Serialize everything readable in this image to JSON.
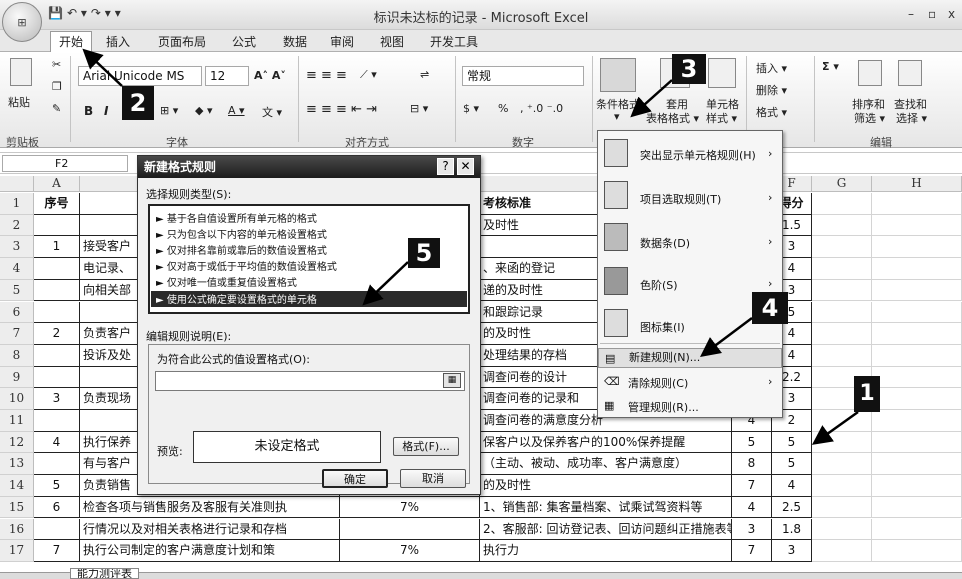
{
  "window": {
    "title": "标识未达标的记录 - Microsoft Excel",
    "controls": [
      "–",
      "▫",
      "x"
    ]
  },
  "qat": [
    "💾",
    "↶ ▾",
    "↷ ▾",
    "▾"
  ],
  "ribbon_tabs": [
    "开始",
    "插入",
    "页面布局",
    "公式",
    "数据",
    "审阅",
    "视图",
    "开发工具"
  ],
  "ribbon": {
    "clipboard": {
      "label": "剪贴板",
      "paste": "粘贴"
    },
    "font": {
      "label": "字体",
      "name": "Arial Unicode MS",
      "size": "12",
      "bold": "B",
      "italic": "I"
    },
    "align": {
      "label": "对齐方式"
    },
    "number": {
      "label": "数字",
      "format": "常规",
      "pct": "%"
    },
    "styles": {
      "cond_line1": "条件格式",
      "cond_line2": "▾",
      "table_line1": "套用",
      "table_line2": "表格格式 ▾",
      "cell_line1": "单元格",
      "cell_line2": "样式 ▾",
      "label": "样式"
    },
    "cells": {
      "insert": "插入 ▾",
      "delete": "删除 ▾",
      "format": "格式 ▾",
      "label": "单元格"
    },
    "editing": {
      "sort1": "排序和",
      "sort2": "筛选 ▾",
      "find1": "查找和",
      "find2": "选择 ▾",
      "label": "编辑",
      "sigma": "Σ ▾"
    }
  },
  "formula_bar": {
    "cell_ref": "F2"
  },
  "columns": [
    "A",
    "B",
    "C",
    "D",
    "E",
    "F",
    "G",
    "H"
  ],
  "rows": [
    {
      "n": "1",
      "a": "序号",
      "b": "",
      "d": "考核标准",
      "e": "",
      "f": "得分"
    },
    {
      "n": "2",
      "a": "",
      "b": "",
      "d": "及时性",
      "e": "",
      "f": "1.5"
    },
    {
      "n": "3",
      "a": "1",
      "b": "接受客户",
      "d": "",
      "e": "",
      "f": "3"
    },
    {
      "n": "4",
      "a": "",
      "b": "电记录、",
      "d": "、来函的登记",
      "e": "",
      "f": "4"
    },
    {
      "n": "5",
      "a": "",
      "b": "向相关部",
      "d": "递的及时性",
      "e": "",
      "f": "3"
    },
    {
      "n": "6",
      "a": "",
      "b": "",
      "d": "和跟踪记录",
      "e": "",
      "f": "5"
    },
    {
      "n": "7",
      "a": "2",
      "b": "负责客户",
      "d": "的及时性",
      "e": "",
      "f": "4"
    },
    {
      "n": "8",
      "a": "",
      "b": "投诉及处",
      "d": "处理结果的存档",
      "e": "",
      "f": "4"
    },
    {
      "n": "9",
      "a": "",
      "b": "",
      "d": "调查问卷的设计",
      "e": "",
      "f": "2.2"
    },
    {
      "n": "10",
      "a": "3",
      "b": "负责现场",
      "d": "调查问卷的记录和",
      "e": "",
      "f": "3"
    },
    {
      "n": "11",
      "a": "",
      "b": "",
      "d": "调查问卷的满意度分析",
      "e": "4",
      "f": "2"
    },
    {
      "n": "12",
      "a": "4",
      "b": "执行保养",
      "d": "保客户以及保养客户的100%保养提醒",
      "e": "5",
      "f": "5"
    },
    {
      "n": "13",
      "a": "",
      "b": "有与客户",
      "d": "（主动、被动、成功率、客户满意度）",
      "e": "8",
      "f": "5"
    },
    {
      "n": "14",
      "a": "5",
      "b": "负责销售",
      "d": "的及时性",
      "e": "7",
      "f": "4"
    },
    {
      "n": "15",
      "a": "6",
      "b": "检查各项与销售服务及客服有关准则执",
      "c": "7%",
      "d": "1、销售部: 集客量档案、试乘试驾资料等",
      "e": "4",
      "f": "2.5"
    },
    {
      "n": "16",
      "a": "",
      "b": "行情况以及对相关表格进行记录和存档",
      "c": "",
      "d": "2、客服部: 回访登记表、回访问题纠正措施表等",
      "e": "3",
      "f": "1.8"
    },
    {
      "n": "17",
      "a": "7",
      "b": "执行公司制定的客户满意度计划和策",
      "c": "7%",
      "d": "执行力",
      "e": "7",
      "f": "3"
    }
  ],
  "sheet_tab": "能力测评表",
  "dialog": {
    "title": "新建格式规则",
    "help": "?",
    "close": "✕",
    "select_label": "选择规则类型(S):",
    "rules": [
      "► 基于各自值设置所有单元格的格式",
      "► 只为包含以下内容的单元格设置格式",
      "► 仅对排名靠前或靠后的数值设置格式",
      "► 仅对高于或低于平均值的数值设置格式",
      "► 仅对唯一值或重复值设置格式",
      "► 使用公式确定要设置格式的单元格"
    ],
    "edit_label": "编辑规则说明(E):",
    "formula_label": "为符合此公式的值设置格式(O):",
    "formula_value": "",
    "preview_label": "预览:",
    "preview_text": "未设定格式",
    "format_btn": "格式(F)...",
    "ok": "确定",
    "cancel": "取消"
  },
  "menu": {
    "items": [
      {
        "label": "突出显示单元格规则(H)",
        "arrow": "›"
      },
      {
        "label": "项目选取规则(T)",
        "arrow": "›"
      },
      {
        "label": "数据条(D)",
        "arrow": "›"
      },
      {
        "label": "色阶(S)",
        "arrow": "›"
      },
      {
        "label": "图标集(I)",
        "arrow": "›"
      },
      {
        "label": "新建规则(N)...",
        "arrow": ""
      },
      {
        "label": "清除规则(C)",
        "arrow": "›"
      },
      {
        "label": "管理规则(R)...",
        "arrow": ""
      }
    ]
  },
  "callouts": [
    "1",
    "2",
    "3",
    "4",
    "5"
  ]
}
